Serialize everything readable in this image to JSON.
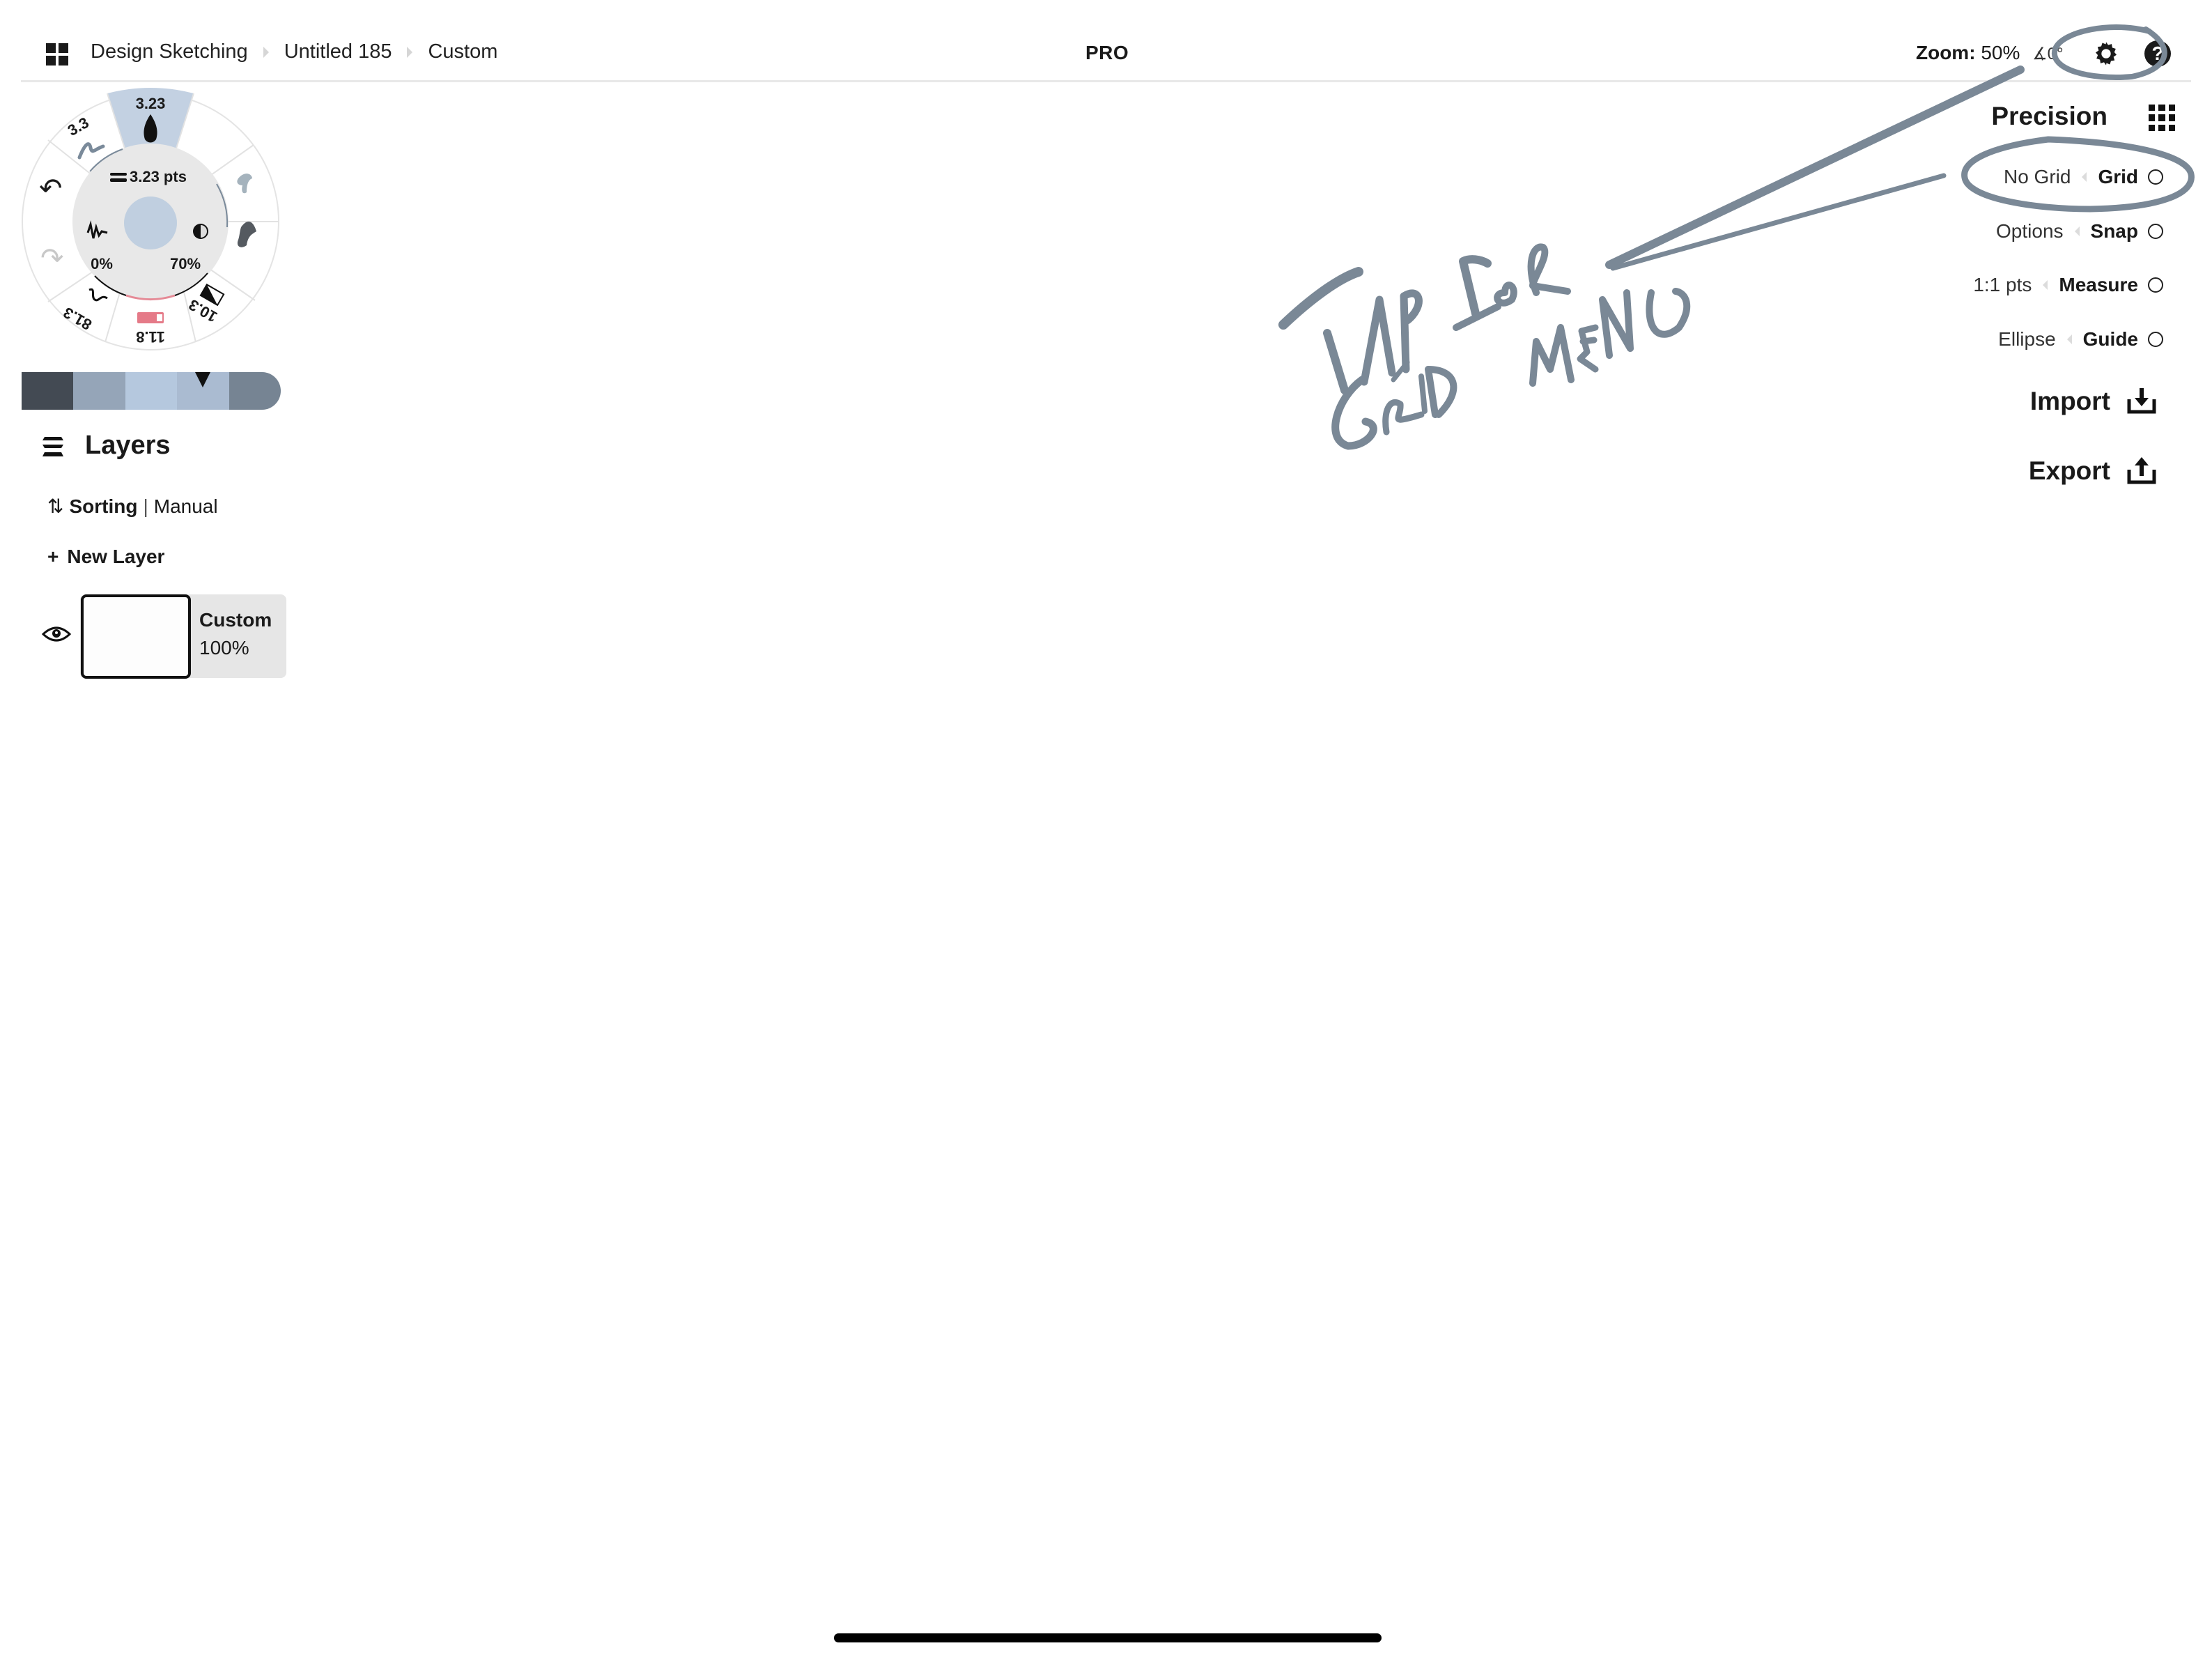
{
  "topbar": {
    "apps_icon": "apps-grid-icon",
    "breadcrumb": [
      "Design Sketching",
      "Untitled 185",
      "Custom"
    ],
    "title": "PRO",
    "zoom_label": "Zoom:",
    "zoom_value": "50%",
    "angle_value": "∡0°",
    "settings_icon": "gear-icon",
    "help_icon": "help-icon",
    "help_glyph": "?"
  },
  "brush_wheel": {
    "size_readout": "3.23 pts",
    "center_color": "#c0cfe0",
    "smoothing": "0%",
    "opacity": "70%",
    "presets": [
      {
        "label": "3.3",
        "name": "pen"
      },
      {
        "label": "3.23",
        "name": "ink",
        "selected": true
      },
      {
        "label": "",
        "name": "marker-light"
      },
      {
        "label": "",
        "name": "marker-dark"
      },
      {
        "label": "10.3",
        "name": "shader"
      },
      {
        "label": "11.8",
        "name": "eraser"
      },
      {
        "label": "81.3",
        "name": "wire"
      }
    ],
    "undo_icon": "undo-icon",
    "redo_icon": "redo-icon"
  },
  "palette": {
    "colors": [
      "#434a53",
      "#95a5b8",
      "#b5c8de",
      "#aabbd1",
      "#768493"
    ],
    "selected_index": 3
  },
  "layers": {
    "title": "Layers",
    "sorting_label": "Sorting",
    "sorting_separator": "|",
    "sorting_value": "Manual",
    "new_layer_label": "New Layer",
    "new_layer_glyph": "+",
    "items": [
      {
        "name": "Custom",
        "opacity": "100%",
        "visible": true
      }
    ]
  },
  "precision": {
    "title": "Precision",
    "rows": [
      {
        "option": "No Grid",
        "label": "Grid"
      },
      {
        "option": "Options",
        "label": "Snap"
      },
      {
        "option": "1:1 pts",
        "label": "Measure"
      },
      {
        "option": "Ellipse",
        "label": "Guide"
      }
    ],
    "import_label": "Import",
    "export_label": "Export"
  },
  "annotation": {
    "text": "TAP FOR GRID MENU",
    "color": "#7a8896"
  }
}
